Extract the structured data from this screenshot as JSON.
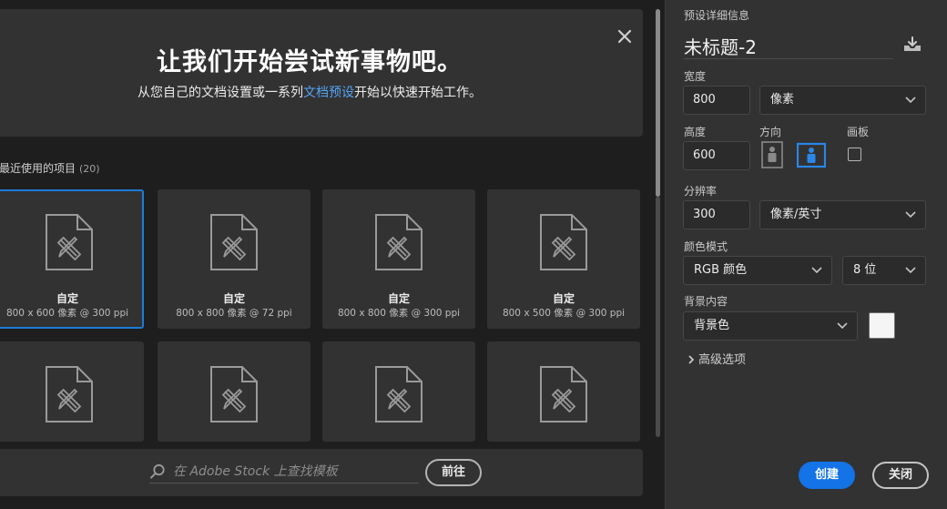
{
  "banner": {
    "title": "让我们开始尝试新事物吧。",
    "subtitle_prefix": "从您自己的文档设置或一系列",
    "subtitle_link": "文档预设",
    "subtitle_suffix": "开始以快速开始工作。"
  },
  "recent": {
    "heading": "您最近使用的项目",
    "count": "(20)",
    "items": [
      {
        "name": "自定",
        "spec": "800 x 600 像素 @ 300 ppi"
      },
      {
        "name": "自定",
        "spec": "800 x 800 像素 @ 72 ppi"
      },
      {
        "name": "自定",
        "spec": "800 x 800 像素 @ 300 ppi"
      },
      {
        "name": "自定",
        "spec": "800 x 500 像素 @ 300 ppi"
      }
    ]
  },
  "stock": {
    "placeholder": "在 Adobe Stock 上查找模板",
    "go_label": "前往"
  },
  "details": {
    "section_title": "预设详细信息",
    "preset_name": "未标题-2",
    "width_label": "宽度",
    "width_value": "800",
    "width_unit": "像素",
    "height_label": "高度",
    "height_value": "600",
    "orientation_label": "方向",
    "artboard_label": "画板",
    "resolution_label": "分辨率",
    "resolution_value": "300",
    "resolution_unit": "像素/英寸",
    "color_mode_label": "颜色模式",
    "color_mode_value": "RGB 颜色",
    "bit_depth_value": "8 位",
    "background_label": "背景内容",
    "background_value": "背景色",
    "advanced_label": "高级选项"
  },
  "actions": {
    "create_label": "创建",
    "close_label": "关闭"
  },
  "colors": {
    "accent": "#1473e6",
    "link": "#55a4f5",
    "background_swatch": "#f5f5f5"
  }
}
